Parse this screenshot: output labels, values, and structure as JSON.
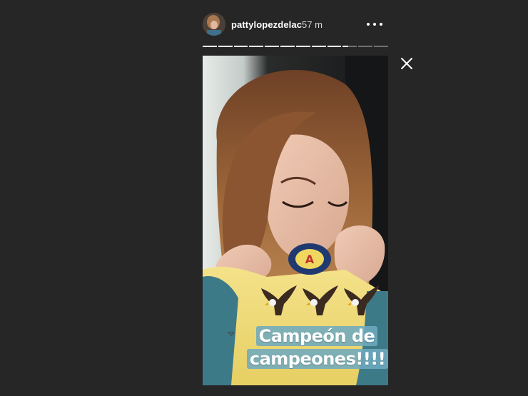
{
  "story": {
    "username": "pattylopezdelac",
    "timestamp": "57 m",
    "progress_segments": [
      1,
      1,
      1,
      1,
      1,
      1,
      1,
      1,
      1,
      0.4,
      0,
      0
    ],
    "caption": {
      "line1": "Campeón de",
      "line2": "campeones!!!!"
    },
    "stickers": [
      "eagle-emoji",
      "eagle-emoji",
      "eagle-emoji"
    ]
  },
  "icons": {
    "more": "more-options-icon",
    "close": "close-icon"
  },
  "colors": {
    "background": "#262626",
    "caption_bg": "#6eaabe",
    "text": "#ffffff"
  }
}
